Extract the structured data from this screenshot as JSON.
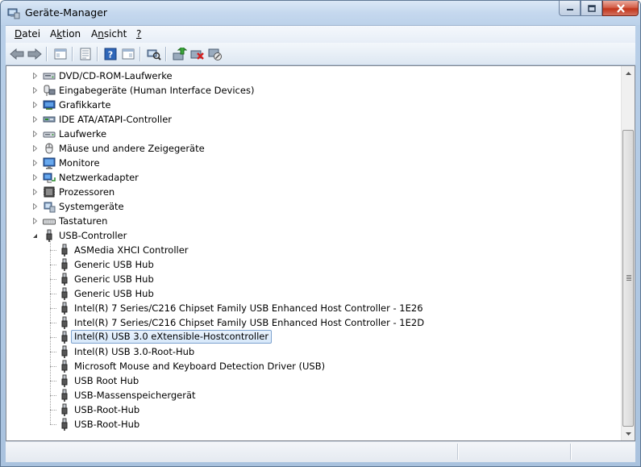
{
  "window": {
    "title": "Geräte-Manager"
  },
  "menu": [
    {
      "label": "Datei",
      "key": "D",
      "rest": "atei"
    },
    {
      "label": "Aktion",
      "key": "k",
      "pre": "A",
      "rest": "tion"
    },
    {
      "label": "Ansicht",
      "key": "n",
      "pre": "A",
      "rest": "sicht"
    },
    {
      "label": "?",
      "key": "?"
    }
  ],
  "toolbar": {
    "icons": [
      "back-arrow-icon",
      "forward-arrow-icon",
      "console-tree-icon",
      "properties-icon",
      "help-icon",
      "show-hide-icon",
      "scan-hardware-icon",
      "update-driver-icon",
      "uninstall-device-icon",
      "disable-device-icon"
    ]
  },
  "tree": {
    "categories": [
      {
        "label": "DVD/CD-ROM-Laufwerke",
        "icon": "dvd-drive-icon"
      },
      {
        "label": "Eingabegeräte (Human Interface Devices)",
        "icon": "hid-icon"
      },
      {
        "label": "Grafikkarte",
        "icon": "display-adapter-icon"
      },
      {
        "label": "IDE ATA/ATAPI-Controller",
        "icon": "ide-controller-icon"
      },
      {
        "label": "Laufwerke",
        "icon": "disk-drive-icon"
      },
      {
        "label": "Mäuse und andere Zeigegeräte",
        "icon": "mouse-icon"
      },
      {
        "label": "Monitore",
        "icon": "monitor-icon"
      },
      {
        "label": "Netzwerkadapter",
        "icon": "network-adapter-icon"
      },
      {
        "label": "Prozessoren",
        "icon": "processor-icon"
      },
      {
        "label": "Systemgeräte",
        "icon": "system-devices-icon"
      },
      {
        "label": "Tastaturen",
        "icon": "keyboard-icon"
      },
      {
        "label": "USB-Controller",
        "icon": "usb-icon"
      }
    ],
    "usb_children": [
      "ASMedia XHCI Controller",
      "Generic USB Hub",
      "Generic USB Hub",
      "Generic USB Hub",
      "Intel(R) 7 Series/C216 Chipset Family USB Enhanced Host Controller - 1E26",
      "Intel(R) 7 Series/C216 Chipset Family USB Enhanced Host Controller - 1E2D",
      "Intel(R) USB 3.0 eXtensible-Hostcontroller",
      "Intel(R) USB 3.0-Root-Hub",
      "Microsoft Mouse and Keyboard Detection Driver (USB)",
      "USB Root Hub",
      "USB-Massenspeichergerät",
      "USB-Root-Hub",
      "USB-Root-Hub"
    ],
    "selected_index": 6
  },
  "colors": {
    "selection_border": "#7da2ce",
    "selection_fill": "#d7e8fa"
  }
}
